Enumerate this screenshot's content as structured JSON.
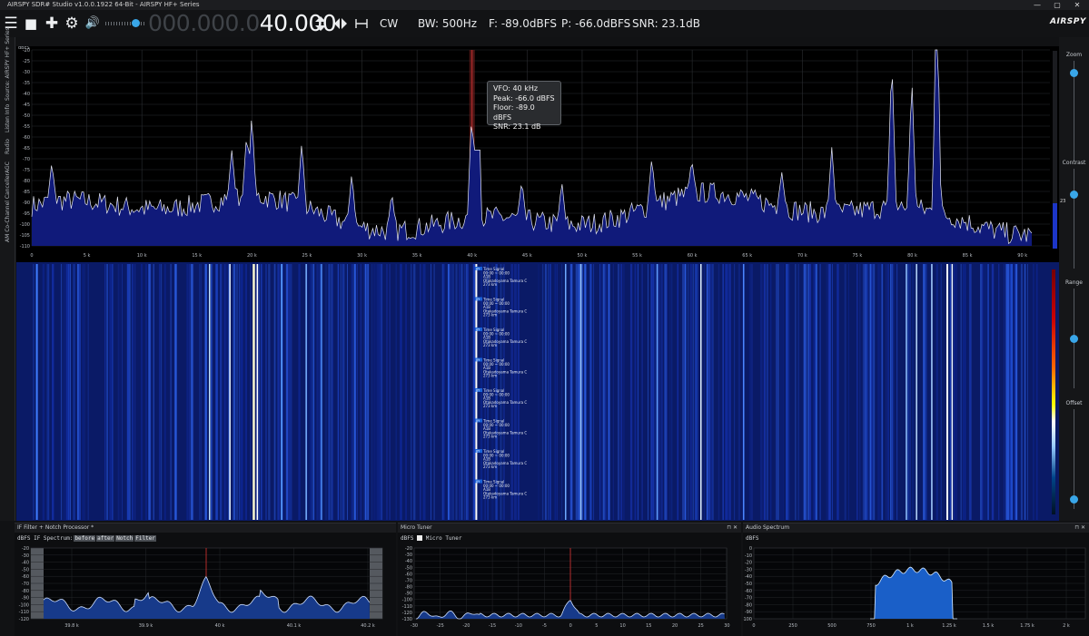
{
  "window": {
    "title": "AIRSPY SDR# Studio v1.0.0.1922 64-Bit - AIRSPY HF+ Series",
    "min": "—",
    "max": "▢",
    "close": "✕"
  },
  "toolbar": {
    "menu_icon": "☰",
    "stop_icon": "■",
    "add_icon": "✚",
    "settings_icon": "⚙",
    "volume_icon": "🔊",
    "freq_dim": "000.000.0",
    "freq_lit": "40.000",
    "mode": "CW",
    "bw": "BW: 500Hz",
    "floor": "F: -89.0dBFS",
    "peak": "P: -66.0dBFS",
    "snr": "SNR: 23.1dB",
    "logo": "AIRSPY"
  },
  "left_tabs": [
    "Source: AIRSPY HF+ Series",
    "Listen Info",
    "Radio",
    "AGC",
    "AM Co-Channel Canceller"
  ],
  "right_panel": {
    "zoom": "Zoom",
    "contrast": "Contrast",
    "range": "Range",
    "offset": "Offset",
    "level_value": "23",
    "zoom_level": 0.88,
    "contrast_level": 0.75,
    "range_level": 0.5,
    "offset_level": 0.1
  },
  "spectrum": {
    "unit": "dBFS",
    "y_ticks": [
      "-20",
      "-25",
      "-30",
      "-35",
      "-40",
      "-45",
      "-50",
      "-55",
      "-60",
      "-65",
      "-70",
      "-75",
      "-80",
      "-85",
      "-90",
      "-95",
      "-100",
      "-105",
      "-110"
    ],
    "x_ticks": [
      "0",
      "5 k",
      "10 k",
      "15 k",
      "20 k",
      "25 k",
      "30 k",
      "35 k",
      "40 k",
      "45 k",
      "50 k",
      "55 k",
      "60 k",
      "65 k",
      "70 k",
      "75 k",
      "80 k",
      "85 k",
      "90 k"
    ]
  },
  "tooltip": {
    "vfo": "VFO:  40 kHz",
    "peak": "Peak:  -66.0 dBFS",
    "floor": "Floor:  -89.0 dBFS",
    "snr": "SNR:  23.1 dB"
  },
  "waterfall": {
    "annotation": {
      "badge": "JJY",
      "l1": "Time Signal",
      "l2": "00:00 ~ 00:00",
      "l3": "A1B",
      "l4": "Otakadoyama Tamura C",
      "l5": "273 km"
    }
  },
  "panels": {
    "if_filter": {
      "title": "IF Filter + Notch Processor *",
      "unit": "dBFS",
      "spectrum_label": "IF Spectrum:",
      "before": "before",
      "after": "after",
      "notch": "Notch",
      "filter": "Filter",
      "y_ticks": [
        "-20",
        "-30",
        "-40",
        "-50",
        "-60",
        "-70",
        "-80",
        "-90",
        "-100",
        "-110",
        "-120"
      ],
      "x_ticks": [
        "39.8 k",
        "39.9 k",
        "40 k",
        "40.1 k",
        "40.2 k"
      ]
    },
    "micro_tuner": {
      "title": "Micro Tuner",
      "unit": "dBFS",
      "checkbox": "Micro Tuner",
      "pin": "⊓ ✕",
      "y_ticks": [
        "-20",
        "-30",
        "-40",
        "-50",
        "-60",
        "-70",
        "-80",
        "-90",
        "-100",
        "-110",
        "-120",
        "-130"
      ],
      "x_ticks": [
        "-30",
        "-25",
        "-20",
        "-15",
        "-10",
        "-5",
        "0",
        "5",
        "10",
        "15",
        "20",
        "25",
        "30"
      ]
    },
    "audio_spectrum": {
      "title": "Audio Spectrum",
      "unit": "dBFS",
      "pin": "⊓ ✕",
      "y_ticks": [
        "0",
        "-10",
        "-20",
        "-30",
        "-40",
        "-50",
        "-60",
        "-70",
        "-80",
        "-90",
        "-100"
      ],
      "x_ticks": [
        "0",
        "250",
        "500",
        "750",
        "1 k",
        "1.25 k",
        "1.5 k",
        "1.75 k",
        "2 k"
      ]
    }
  }
}
